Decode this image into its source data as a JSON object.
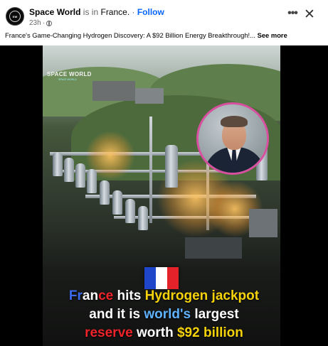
{
  "post": {
    "page_name": "Space World",
    "is_in": " is in ",
    "location": "France.",
    "separator": " · ",
    "follow_label": "Follow",
    "timestamp": "23h",
    "dot": "·",
    "more_icon": "more-horizontal-icon",
    "close_icon": "close-icon",
    "caption": "France's Game-Changing Hydrogen Discovery: A $92 Billion Energy Breakthrough!... ",
    "see_more": "See more"
  },
  "image": {
    "watermark": "SPACE WORLD",
    "watermark_sub": "SPACE WORLD",
    "flag_colors": [
      "#1f46c8",
      "#ffffff",
      "#e32229"
    ],
    "headline": {
      "line1": [
        {
          "text": "Fr",
          "color": "blue"
        },
        {
          "text": "an",
          "color": "white"
        },
        {
          "text": "ce",
          "color": "red"
        },
        {
          "text": " hits ",
          "color": "white"
        },
        {
          "text": "Hydrogen jackpot",
          "color": "yellow"
        }
      ],
      "line2": [
        {
          "text": "and it is ",
          "color": "white"
        },
        {
          "text": "world's",
          "color": "lightblue"
        },
        {
          "text": " largest",
          "color": "white"
        }
      ],
      "line3": [
        {
          "text": "reserve",
          "color": "red"
        },
        {
          "text": " worth ",
          "color": "white"
        },
        {
          "text": "$92 billion",
          "color": "yellow"
        }
      ]
    }
  }
}
